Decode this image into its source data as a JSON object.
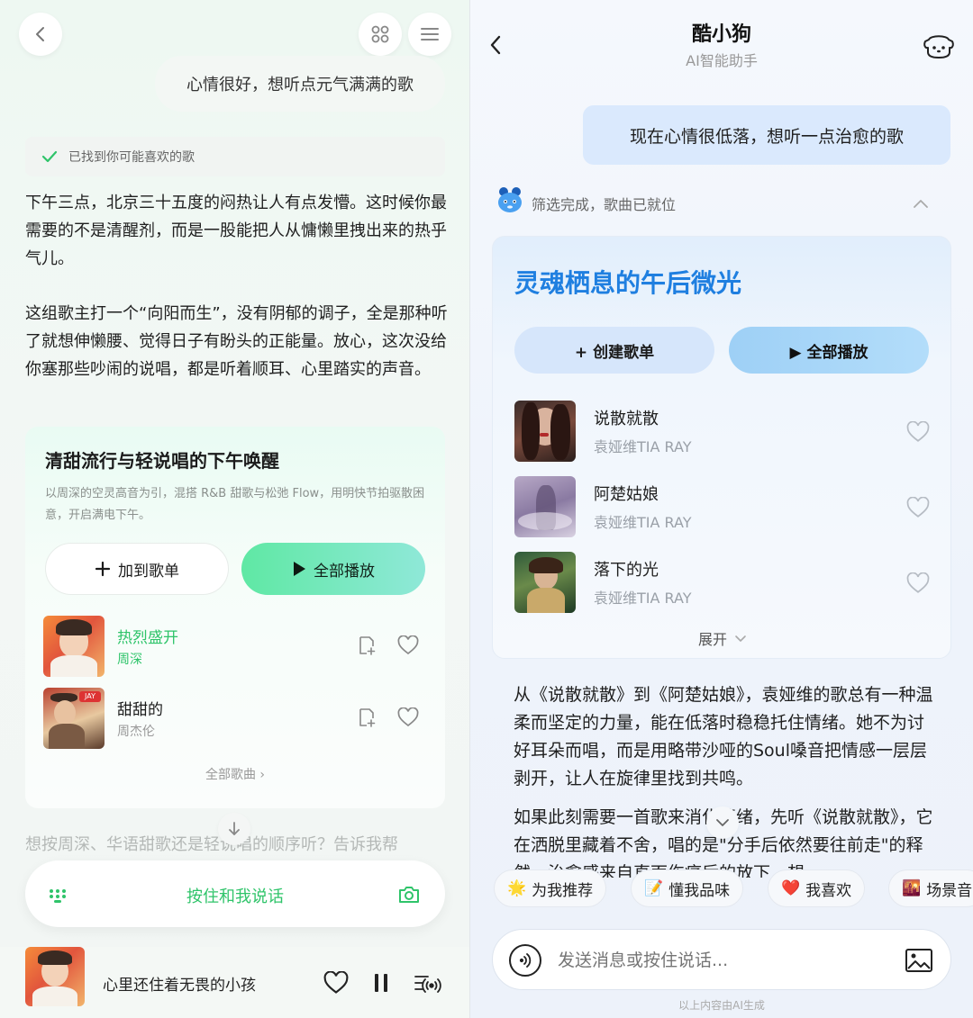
{
  "left": {
    "user_message": "心情很好，想听点元气满满的歌",
    "found_status": "已找到你可能喜欢的歌",
    "paragraph1": "下午三点，北京三十五度的闷热让人有点发懵。这时候你最需要的不是清醒剂，而是一股能把人从慵懒里拽出来的热乎气儿。",
    "paragraph2": "这组歌主打一个“向阳而生”，没有阴郁的调子，全是那种听了就想伸懒腰、觉得日子有盼头的正能量。放心，这次没给你塞那些吵闹的说唱，都是听着顺耳、心里踏实的声音。",
    "card": {
      "title": "清甜流行与轻说唱的下午唤醒",
      "description": "以周深的空灵高音为引，混搭 R&B 甜歌与松弛 Flow，用明快节拍驱散困意，开启满电下午。",
      "add_label": "加到歌单",
      "play_all_label": "全部播放",
      "songs": [
        {
          "name": "热烈盛开",
          "artist": "周深",
          "active": true
        },
        {
          "name": "甜甜的",
          "artist": "周杰伦",
          "active": false
        }
      ],
      "all_songs_label": "全部歌曲 ›"
    },
    "followup_text": "想按周深、华语甜歌还是轻说唱的顺序听？告诉我帮",
    "voice_label": "按住和我说话",
    "player": {
      "song_title": "心里还住着无畏的小孩"
    },
    "colors": {
      "accent": "#2fc46a"
    }
  },
  "right": {
    "header": {
      "title": "酷小狗",
      "subtitle": "AI智能助手"
    },
    "user_message": "现在心情很低落，想听一点治愈的歌",
    "status": "筛选完成，歌曲已就位",
    "card": {
      "title": "灵魂栖息的午后微光",
      "create_label": "+ 创建歌单",
      "play_all_label": "▶ 全部播放",
      "songs": [
        {
          "name": "说散就散",
          "artist": "袁娅维TIA RAY"
        },
        {
          "name": "阿楚姑娘",
          "artist": "袁娅维TIA RAY"
        },
        {
          "name": "落下的光",
          "artist": "袁娅维TIA RAY"
        }
      ],
      "expand_label": "展开"
    },
    "paragraph1": "从《说散就散》到《阿楚姑娘》，袁娅维的歌总有一种温柔而坚定的力量，能在低落时稳稳托住情绪。她不为讨好耳朵而唱，而是用略带沙哑的Soul嗓音把情感一层层剥开，让人在旋律里找到共鸣。",
    "paragraph2": "如果此刻需要一首歌来消化情绪，先听《说散就散》，它在洒脱里藏着不舍，唱的是\"分手后依然要往前走\"的释然，治愈感来自直面伤痛后的放下，想",
    "chips": [
      {
        "icon": "🌟",
        "label": "为我推荐"
      },
      {
        "icon": "📝",
        "label": "懂我品味"
      },
      {
        "icon": "❤️",
        "label": "我喜欢"
      },
      {
        "icon": "🌇",
        "label": "场景音"
      }
    ],
    "input_placeholder": "发送消息或按住说话...",
    "footer_note": "以上内容由AI生成",
    "colors": {
      "accent": "#1f7fe0"
    }
  }
}
